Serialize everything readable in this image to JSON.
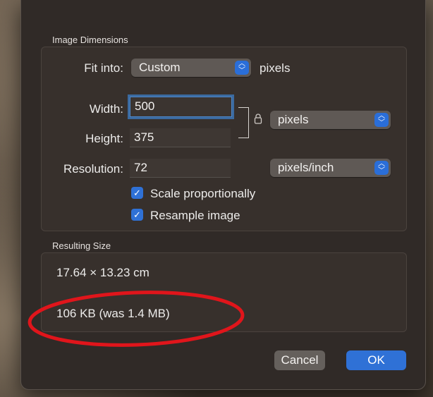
{
  "dialog": {
    "dimensions_title": "Image Dimensions",
    "fit_into_label": "Fit into:",
    "fit_into_value": "Custom",
    "fit_into_unit": "pixels",
    "width_label": "Width:",
    "width_value": "500",
    "height_label": "Height:",
    "height_value": "375",
    "size_unit": "pixels",
    "resolution_label": "Resolution:",
    "resolution_value": "72",
    "resolution_unit": "pixels/inch",
    "scale_proportionally_label": "Scale proportionally",
    "scale_proportionally_checked": true,
    "resample_label": "Resample image",
    "resample_checked": true,
    "result_title": "Resulting Size",
    "result_dimensions": "17.64 × 13.23 cm",
    "result_filesize": "106 KB (was 1.4 MB)",
    "cancel_label": "Cancel",
    "ok_label": "OK"
  },
  "icons": {
    "lock": "lock-icon",
    "chevrons": "chevron-updown-icon",
    "checkmark": "checkmark-icon"
  },
  "colors": {
    "accent": "#2f71d6",
    "annotation": "#e0151b"
  }
}
